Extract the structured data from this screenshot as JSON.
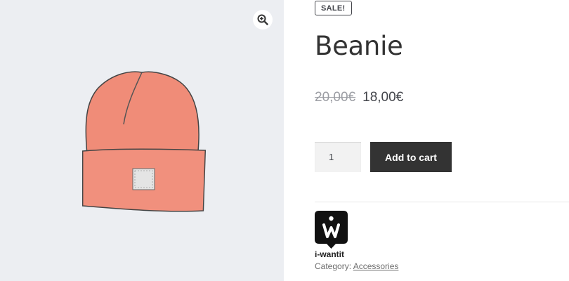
{
  "product": {
    "badge": "SALE!",
    "title": "Beanie",
    "regular_price": "20,00€",
    "sale_price": "18,00€",
    "quantity": "1",
    "add_to_cart_label": "Add to cart",
    "brand_name": "i-wantit",
    "category_label": "Category:",
    "category": "Accessories"
  },
  "icons": {
    "zoom": "magnifier-zoom-icon",
    "brand": "i-wantit-logo"
  },
  "colors": {
    "button_bg": "#333333",
    "gallery_bg": "#eceef2",
    "beanie": "#ee8a76"
  }
}
